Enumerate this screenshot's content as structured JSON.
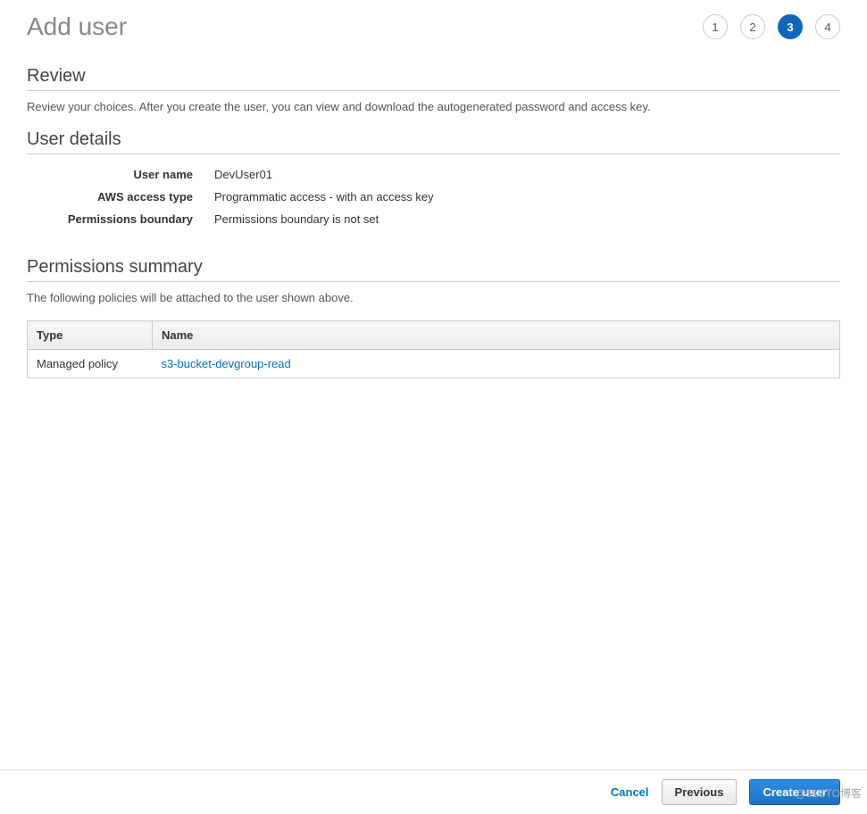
{
  "header": {
    "title": "Add user"
  },
  "stepper": {
    "steps": [
      "1",
      "2",
      "3",
      "4"
    ],
    "active_index": 2
  },
  "review": {
    "heading": "Review",
    "description": "Review your choices. After you create the user, you can view and download the autogenerated password and access key."
  },
  "user_details": {
    "heading": "User details",
    "rows": [
      {
        "label": "User name",
        "value": "DevUser01"
      },
      {
        "label": "AWS access type",
        "value": "Programmatic access - with an access key"
      },
      {
        "label": "Permissions boundary",
        "value": "Permissions boundary is not set"
      }
    ]
  },
  "permissions_summary": {
    "heading": "Permissions summary",
    "description": "The following policies will be attached to the user shown above.",
    "columns": {
      "type": "Type",
      "name": "Name"
    },
    "rows": [
      {
        "type": "Managed policy",
        "name": "s3-bucket-devgroup-read"
      }
    ]
  },
  "footer": {
    "cancel": "Cancel",
    "previous": "Previous",
    "create": "Create user"
  },
  "watermark": "@51CTO博客"
}
